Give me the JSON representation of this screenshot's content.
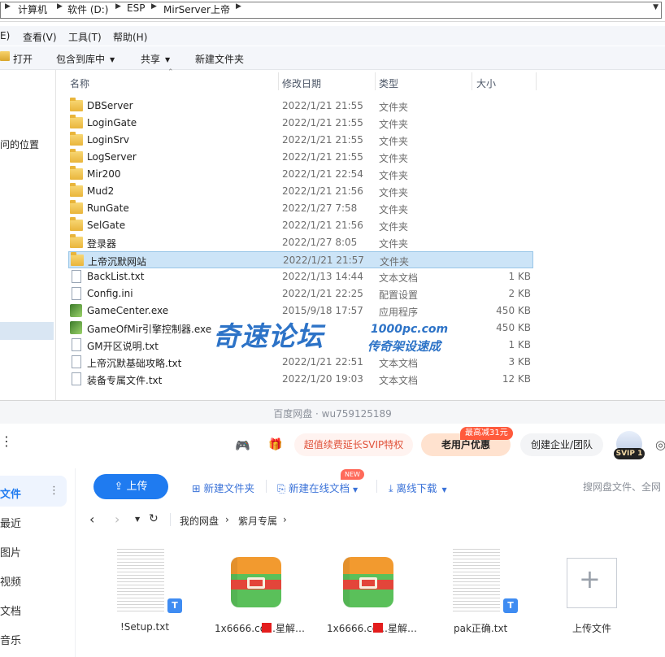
{
  "explorer": {
    "breadcrumbs": [
      "计算机",
      "软件 (D:)",
      "ESP",
      "MirServer上帝"
    ],
    "menu": [
      "E)",
      "查看(V)",
      "工具(T)",
      "帮助(H)"
    ],
    "toolbar": {
      "open": "打开",
      "include": "包含到库中",
      "share": "共享",
      "new_folder": "新建文件夹"
    },
    "nav_text": "问的位置",
    "columns": {
      "name": "名称",
      "date": "修改日期",
      "type": "类型",
      "size": "大小"
    },
    "files": [
      {
        "name": "DBServer",
        "date": "2022/1/21 21:55",
        "type": "文件夹",
        "size": "",
        "icon": "folder"
      },
      {
        "name": "LoginGate",
        "date": "2022/1/21 21:55",
        "type": "文件夹",
        "size": "",
        "icon": "folder"
      },
      {
        "name": "LoginSrv",
        "date": "2022/1/21 21:55",
        "type": "文件夹",
        "size": "",
        "icon": "folder"
      },
      {
        "name": "LogServer",
        "date": "2022/1/21 21:55",
        "type": "文件夹",
        "size": "",
        "icon": "folder"
      },
      {
        "name": "Mir200",
        "date": "2022/1/21 22:54",
        "type": "文件夹",
        "size": "",
        "icon": "folder"
      },
      {
        "name": "Mud2",
        "date": "2022/1/21 21:56",
        "type": "文件夹",
        "size": "",
        "icon": "folder"
      },
      {
        "name": "RunGate",
        "date": "2022/1/27 7:58",
        "type": "文件夹",
        "size": "",
        "icon": "folder"
      },
      {
        "name": "SelGate",
        "date": "2022/1/21 21:56",
        "type": "文件夹",
        "size": "",
        "icon": "folder"
      },
      {
        "name": "登录器",
        "date": "2022/1/27 8:05",
        "type": "文件夹",
        "size": "",
        "icon": "folder"
      },
      {
        "name": "上帝沉默网站",
        "date": "2022/1/21 21:57",
        "type": "文件夹",
        "size": "",
        "icon": "folder",
        "selected": true
      },
      {
        "name": "BackList.txt",
        "date": "2022/1/13 14:44",
        "type": "文本文档",
        "size": "1 KB",
        "icon": "doc"
      },
      {
        "name": "Config.ini",
        "date": "2022/1/21 22:25",
        "type": "配置设置",
        "size": "2 KB",
        "icon": "doc"
      },
      {
        "name": "GameCenter.exe",
        "date": "2015/9/18 17:57",
        "type": "应用程序",
        "size": "450 KB",
        "icon": "exe"
      },
      {
        "name": "GameOfMir引擎控制器.exe",
        "date": "",
        "type": "",
        "size": "450 KB",
        "icon": "exe"
      },
      {
        "name": "GM开区说明.txt",
        "date": "",
        "type": "",
        "size": "1 KB",
        "icon": "doc"
      },
      {
        "name": "上帝沉默基础攻略.txt",
        "date": "2022/1/21 22:51",
        "type": "文本文档",
        "size": "3 KB",
        "icon": "doc"
      },
      {
        "name": "装备专属文件.txt",
        "date": "2022/1/20 19:03",
        "type": "文本文档",
        "size": "12 KB",
        "icon": "doc"
      }
    ]
  },
  "watermark": {
    "main": "奇速论坛",
    "url": "1000pc.com",
    "sub": "传奇架设速成"
  },
  "netdisk": {
    "title": "百度网盘 · wu759125189",
    "header": {
      "promo": "超值续费延长SVIP特权",
      "offer": "老用户优惠",
      "offer_badge": "最高减31元",
      "enterprise": "创建企业/团队",
      "svip": "SVIP 1"
    },
    "sidebar": [
      "文件",
      "最近",
      "图片",
      "视频",
      "文档",
      "音乐"
    ],
    "actions": {
      "upload": "上传",
      "new_folder": "新建文件夹",
      "new_doc": "新建在线文档",
      "new_badge": "NEW",
      "offline": "离线下载",
      "search": "搜网盘文件、全网"
    },
    "path": [
      "我的网盘",
      "紫月专属"
    ],
    "tiles": [
      {
        "label": "!Setup.txt",
        "kind": "txt"
      },
      {
        "label": "1x6666.co…星解…",
        "kind": "zip"
      },
      {
        "label": "1x6666.co…星解…",
        "kind": "zip"
      },
      {
        "label": "pak正确.txt",
        "kind": "txt"
      },
      {
        "label": "上传文件",
        "kind": "upload"
      }
    ]
  },
  "colors": {
    "accent": "#1f7bf0",
    "watermark": "#2d73c7",
    "selection": "#cce4f7",
    "promo": "#e0523a"
  }
}
